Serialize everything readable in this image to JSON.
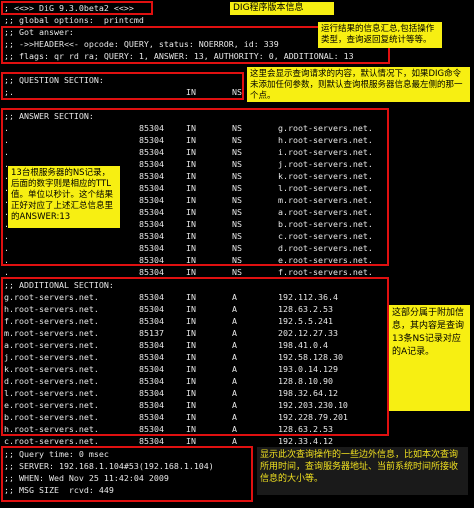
{
  "terminal": {
    "header_lines": [
      "; <<>> DiG 9.3.0beta2 <<>>",
      ";; global options:  printcmd",
      ";; Got answer:",
      ";; ->>HEADER<<- opcode: QUERY, status: NOERROR, id: 339",
      ";; flags: qr rd ra; QUERY: 1, ANSWER: 13, AUTHORITY: 0, ADDITIONAL: 13"
    ],
    "question": {
      "title": ";; QUESTION SECTION:",
      "row": [
        ";.",
        "IN",
        "NS"
      ]
    },
    "answer": {
      "title": ";; ANSWER SECTION:",
      "rows": [
        [
          ".",
          "85304",
          "IN",
          "NS",
          "g.root-servers.net."
        ],
        [
          ".",
          "85304",
          "IN",
          "NS",
          "h.root-servers.net."
        ],
        [
          ".",
          "85304",
          "IN",
          "NS",
          "i.root-servers.net."
        ],
        [
          ".",
          "85304",
          "IN",
          "NS",
          "j.root-servers.net."
        ],
        [
          ".",
          "85304",
          "IN",
          "NS",
          "k.root-servers.net."
        ],
        [
          ".",
          "85304",
          "IN",
          "NS",
          "l.root-servers.net."
        ],
        [
          ".",
          "85304",
          "IN",
          "NS",
          "m.root-servers.net."
        ],
        [
          ".",
          "85304",
          "IN",
          "NS",
          "a.root-servers.net."
        ],
        [
          ".",
          "85304",
          "IN",
          "NS",
          "b.root-servers.net."
        ],
        [
          ".",
          "85304",
          "IN",
          "NS",
          "c.root-servers.net."
        ],
        [
          ".",
          "85304",
          "IN",
          "NS",
          "d.root-servers.net."
        ],
        [
          ".",
          "85304",
          "IN",
          "NS",
          "e.root-servers.net."
        ],
        [
          ".",
          "85304",
          "IN",
          "NS",
          "f.root-servers.net."
        ]
      ]
    },
    "additional": {
      "title": ";; ADDITIONAL SECTION:",
      "rows": [
        [
          "g.root-servers.net.",
          "85304",
          "IN",
          "A",
          "192.112.36.4"
        ],
        [
          "h.root-servers.net.",
          "85304",
          "IN",
          "A",
          "128.63.2.53"
        ],
        [
          "f.root-servers.net.",
          "85304",
          "IN",
          "A",
          "192.5.5.241"
        ],
        [
          "m.root-servers.net.",
          "85137",
          "IN",
          "A",
          "202.12.27.33"
        ],
        [
          "a.root-servers.net.",
          "85304",
          "IN",
          "A",
          "198.41.0.4"
        ],
        [
          "j.root-servers.net.",
          "85304",
          "IN",
          "A",
          "192.58.128.30"
        ],
        [
          "k.root-servers.net.",
          "85304",
          "IN",
          "A",
          "193.0.14.129"
        ],
        [
          "d.root-servers.net.",
          "85304",
          "IN",
          "A",
          "128.8.10.90"
        ],
        [
          "l.root-servers.net.",
          "85304",
          "IN",
          "A",
          "198.32.64.12"
        ],
        [
          "e.root-servers.net.",
          "85304",
          "IN",
          "A",
          "192.203.230.10"
        ],
        [
          "b.root-servers.net.",
          "85304",
          "IN",
          "A",
          "192.228.79.201"
        ],
        [
          "h.root-servers.net.",
          "85304",
          "IN",
          "A",
          "128.63.2.53"
        ],
        [
          "c.root-servers.net.",
          "85304",
          "IN",
          "A",
          "192.33.4.12"
        ]
      ]
    },
    "footer_lines": [
      ";; Query time: 0 msec",
      ";; SERVER: 192.168.1.104#53(192.168.1.104)",
      ";; WHEN: Wed Nov 25 11:42:04 2009",
      ";; MSG SIZE  rcvd: 449"
    ]
  },
  "notes": {
    "version": "DIG程序版本信息",
    "summary": "运行结果的信息汇总,包括操作类型，查询返回复统计等等。",
    "question": "这里会显示查询请求的内容，默认情况下，如果DIG命令未添加任何参数，则默认查询根服务器信息最左侧的那一个点。",
    "answer": "13台根服务器的NS记录，后面的数字则是相应的TTL值。单位以秒计。这个结果正好对应了上述汇总信息里的ANSWER:13",
    "additional": "这部分属于附加信息，其内容是查询13条NS记录对应的A记录。",
    "footer": "显示此次查询操作的一些边外信息，比如本次查询所用时间，查询服务器地址、当前系统时间所接收信息的大小等。"
  }
}
